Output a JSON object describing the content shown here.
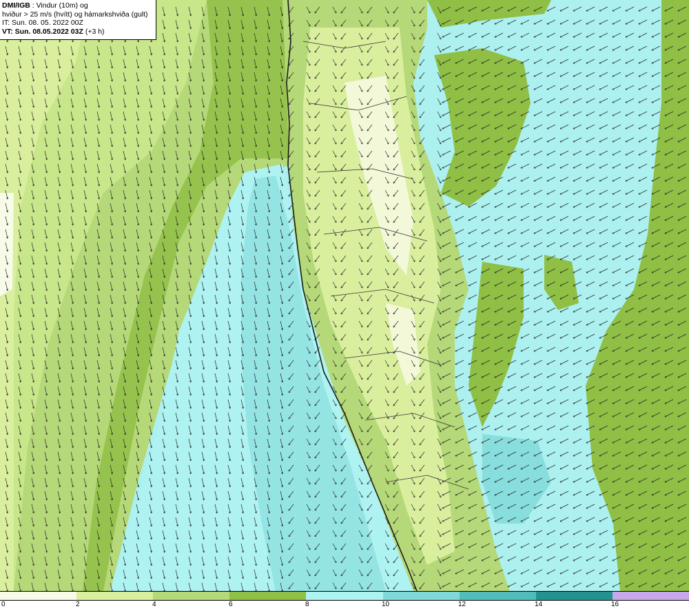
{
  "info": {
    "brand": "DMI/IGB",
    "line1_rest": " : Vindur (10m) og",
    "line2": "hviður > 25 m/s (hvítt) og hámarkshviða (gult)",
    "line3": "IT: Sun. 08. 05. 2022 00Z",
    "vt_label": "VT: Sun. 08.05.2022 03Z",
    "vt_suffix": " (+3 h)"
  },
  "legend": {
    "colors": [
      "#f7fbe8",
      "#d9ef9e",
      "#b5d878",
      "#8fbf45",
      "#aef2f2",
      "#80d8d8",
      "#52bcbc",
      "#24938f",
      "#c8a8ec"
    ],
    "ticks": [
      "0",
      "2",
      "4",
      "6",
      "8",
      "10",
      "12",
      "14",
      "16"
    ]
  }
}
